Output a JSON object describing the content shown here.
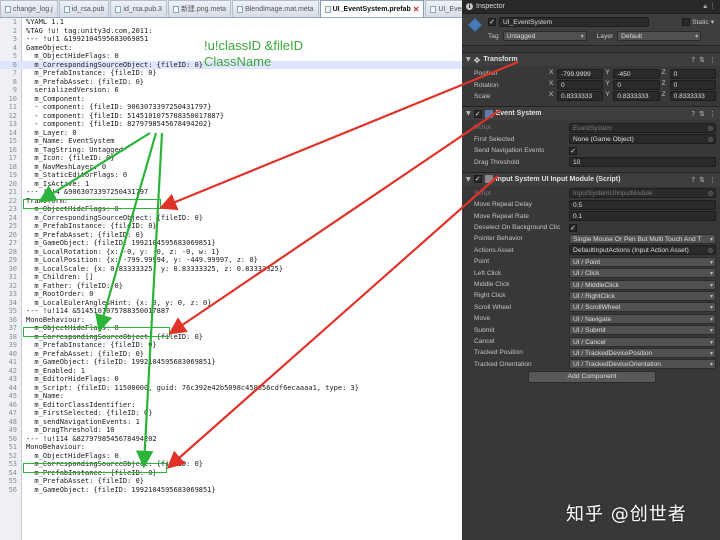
{
  "editor": {
    "tabs": [
      {
        "label": "change_log.j",
        "active": false
      },
      {
        "label": "id_rsa.pub",
        "active": false
      },
      {
        "label": "id_rsa.pub.3",
        "active": false
      },
      {
        "label": "新建.png.meta",
        "active": false
      },
      {
        "label": "BlendImage.mat.meta",
        "active": false
      },
      {
        "label": "UI_EventSystem.prefab",
        "active": true
      },
      {
        "label": "UI_Even",
        "active": false
      }
    ],
    "lines": [
      "%YAML 1.1",
      "%TAG !u! tag:unity3d.com,2011:",
      "--- !u!1 &1992104595683069851",
      "GameObject:",
      "  m_ObjectHideFlags: 0",
      "  m_CorrespondingSourceObject: {fileID: 0}",
      "  m_PrefabInstance: {fileID: 0}",
      "  m_PrefabAsset: {fileID: 0}",
      "  serializedVersion: 6",
      "  m_Component:",
      "  - component: {fileID: 9063073397250431797}",
      "  - component: {fileID: 5145101075788350017887}",
      "  - component: {fileID: 8279798545678494202}",
      "  m_Layer: 0",
      "  m_Name: EventSystem",
      "  m_TagString: Untagged",
      "  m_Icon: {fileID: 0}",
      "  m_NavMeshLayer: 0",
      "  m_StaticEditorFlags: 0",
      "  m_IsActive: 1",
      "--- !u!4 &9063073397250431797",
      "Transform:",
      "  m_ObjectHideFlags: 0",
      "  m_CorrespondingSourceObject: {fileID: 0}",
      "  m_PrefabInstance: {fileID: 0}",
      "  m_PrefabAsset: {fileID: 0}",
      "  m_GameObject: {fileID: 1992104595683069851}",
      "  m_LocalRotation: {x: -0, y: -0, z: -0, w: 1}",
      "  m_LocalPosition: {x: -799.99994, y: -449.99997, z: 0}",
      "  m_LocalScale: {x: 0.83333325, y: 0.83333325, z: 0.83333325}",
      "  m_Children: []",
      "  m_Father: {fileID: 0}",
      "  m_RootOrder: 0",
      "  m_LocalEulerAnglesHint: {x: 0, y: 0, z: 0}",
      "--- !u!114 &5145101075788350017887",
      "MonoBehaviour:",
      "  m_ObjectHideFlags: 0",
      "  m_CorrespondingSourceObject: {fileID: 0}",
      "  m_PrefabInstance: {fileID: 0}",
      "  m_PrefabAsset: {fileID: 0}",
      "  m_GameObject: {fileID: 1992104595683069851}",
      "  m_Enabled: 1",
      "  m_EditorHideFlags: 0",
      "  m_Script: {fileID: 11500000, guid: 76c392e42b5098c458856cdf6ecaaaa1, type: 3}",
      "  m_Name:",
      "  m_EditorClassIdentifier:",
      "  m_FirstSelected: {fileID: 0}",
      "  m_sendNavigationEvents: 1",
      "  m_DragThreshold: 10",
      "--- !u!114 &8279798545678494202",
      "MonoBehaviour:",
      "  m_ObjectHideFlags: 0",
      "  m_CorrespondingSourceObject: {fileID: 0}",
      "  m_PrefabInstance: {fileID: 0}",
      "  m_PrefabAsset: {fileID: 0}",
      "  m_GameObject: {fileID: 1992104595683069851}"
    ],
    "highlighted_line": 6,
    "annotation": "!u!classID &fileID\nClassName"
  },
  "inspector": {
    "tab_label": "Inspector",
    "object_name": "UI_EventSystem",
    "static_label": "Static",
    "tag_label": "Tag",
    "tag_value": "Untagged",
    "layer_label": "Layer",
    "layer_value": "Default",
    "transform": {
      "title": "Transform",
      "rows": [
        {
          "label": "Position",
          "x": "-799.9999",
          "y": "-450",
          "z": "0"
        },
        {
          "label": "Rotation",
          "x": "0",
          "y": "0",
          "z": "0"
        },
        {
          "label": "Scale",
          "x": "0.8333333",
          "y": "0.8333333",
          "z": "0.8333333"
        }
      ]
    },
    "event_system": {
      "title": "Event System",
      "script_label": "Script",
      "script_value": "EventSystem",
      "first_selected_label": "First Selected",
      "first_selected_value": "None (Game Object)",
      "send_nav_label": "Send Navigation Events",
      "drag_label": "Drag Threshold",
      "drag_value": "10"
    },
    "input_module": {
      "title": "Input System UI Input Module (Script)",
      "script_label": "Script",
      "script_value": "InputSystemUIInputModule",
      "repeat_delay_label": "Move Repeat Delay",
      "repeat_delay_value": "0.5",
      "repeat_rate_label": "Move Repeat Rate",
      "repeat_rate_value": "0.1",
      "deselect_label": "Deselect On Background Clic",
      "pointer_behavior_label": "Pointer Behavior",
      "pointer_behavior_value": "Single Mouse Or Pen But Multi Touch And T",
      "actions_asset_label": "Actions Asset",
      "actions_asset_value": "DefaultInputActions (Input Action Asset)",
      "actions": [
        {
          "label": "Point",
          "value": "UI / Point"
        },
        {
          "label": "Left Click",
          "value": "UI / Click"
        },
        {
          "label": "Middle Click",
          "value": "UI / MiddleClick"
        },
        {
          "label": "Right Click",
          "value": "UI / RightClick"
        },
        {
          "label": "Scroll Wheel",
          "value": "UI / ScrollWheel"
        },
        {
          "label": "Move",
          "value": "UI / Navigate"
        },
        {
          "label": "Submit",
          "value": "UI / Submit"
        },
        {
          "label": "Cancel",
          "value": "UI / Cancel"
        },
        {
          "label": "Tracked Position",
          "value": "UI / TrackedDevicePosition"
        },
        {
          "label": "Tracked Orientation",
          "value": "UI / TrackedDeviceOrientation"
        }
      ]
    },
    "add_component_label": "Add Component"
  },
  "watermark": "知乎 @创世者",
  "colors": {
    "green": "#2bb33a",
    "red": "#e0342a"
  }
}
